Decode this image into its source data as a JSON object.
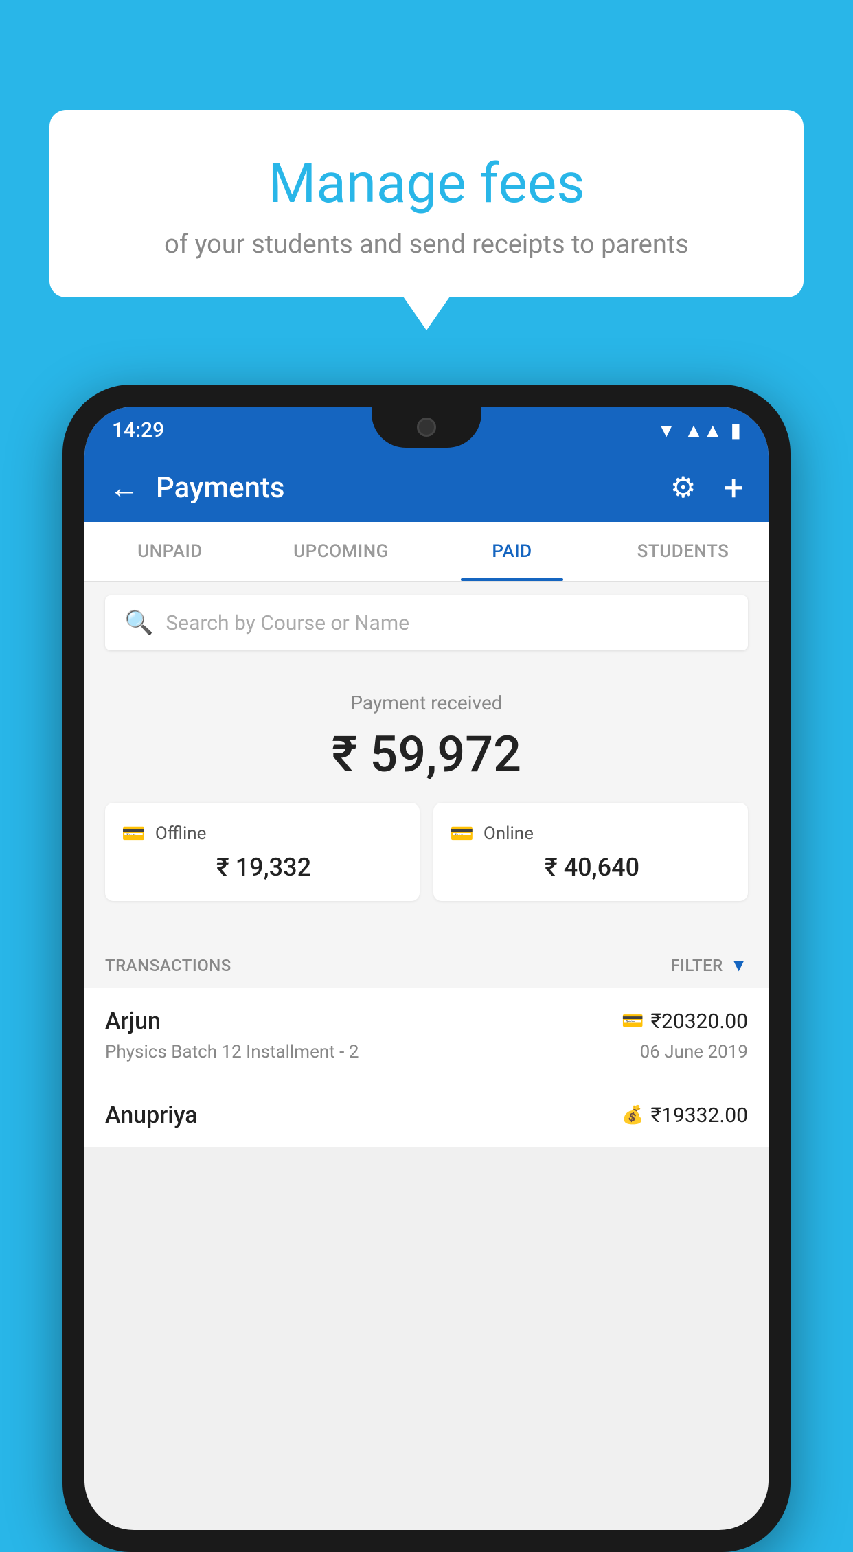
{
  "background_color": "#29b6e8",
  "speech_bubble": {
    "title": "Manage fees",
    "subtitle": "of your students and send receipts to parents"
  },
  "status_bar": {
    "time": "14:29",
    "wifi": "▼",
    "signal": "▲",
    "battery": "▮"
  },
  "app_bar": {
    "title": "Payments",
    "back_label": "←",
    "gear_label": "⚙",
    "plus_label": "+"
  },
  "tabs": [
    {
      "label": "UNPAID",
      "active": false
    },
    {
      "label": "UPCOMING",
      "active": false
    },
    {
      "label": "PAID",
      "active": true
    },
    {
      "label": "STUDENTS",
      "active": false
    }
  ],
  "search": {
    "placeholder": "Search by Course or Name"
  },
  "payment_received": {
    "label": "Payment received",
    "amount": "₹ 59,972",
    "offline": {
      "type": "Offline",
      "amount": "₹ 19,332"
    },
    "online": {
      "type": "Online",
      "amount": "₹ 40,640"
    }
  },
  "transactions": {
    "label": "TRANSACTIONS",
    "filter_label": "FILTER",
    "items": [
      {
        "name": "Arjun",
        "amount": "₹20320.00",
        "course": "Physics Batch 12 Installment - 2",
        "date": "06 June 2019",
        "payment_type": "card"
      },
      {
        "name": "Anupriya",
        "amount": "₹19332.00",
        "course": "",
        "date": "",
        "payment_type": "wallet"
      }
    ]
  }
}
